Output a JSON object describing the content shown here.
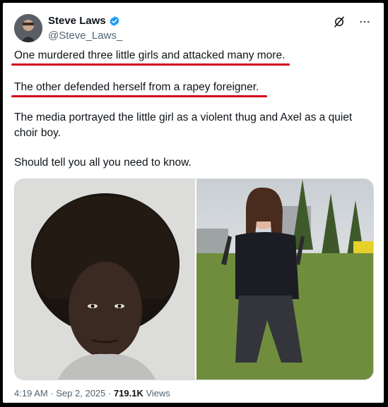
{
  "author": {
    "name": "Steve Laws",
    "handle": "@Steve_Laws_"
  },
  "post": {
    "line1": "One murdered three little girls and attacked many more.",
    "line2": "The other defended herself from a rapey foreigner.",
    "line3": "The media portrayed the little girl as a violent thug and Axel as a quiet choir boy.",
    "line4": "Should tell you all you need to know."
  },
  "meta": {
    "time": "4:19 AM",
    "sep1": " · ",
    "date": "Sep 2, 2025",
    "sep2": " · ",
    "views_count": "719.1K",
    "views_label": " Views"
  },
  "colors": {
    "underline": "#d0021b",
    "verified": "#1d9bf0"
  },
  "icons": [
    "verified-badge-icon",
    "grok-icon",
    "more-options-icon"
  ]
}
